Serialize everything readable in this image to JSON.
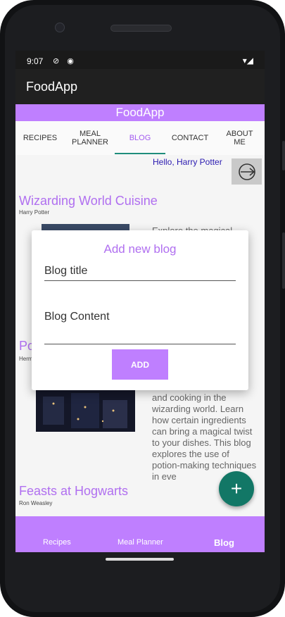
{
  "status": {
    "time": "9:07",
    "left_icons": "⊘ ◉",
    "right_icons": "▾◢"
  },
  "appbar": {
    "title": "FoodApp"
  },
  "banner": {
    "title": "FoodApp"
  },
  "tabs": [
    {
      "label": "RECIPES"
    },
    {
      "label": "MEAL PLANNER"
    },
    {
      "label": "BLOG"
    },
    {
      "label": "CONTACT"
    },
    {
      "label": "ABOUT ME"
    }
  ],
  "greeting": "Hello, Harry Potter",
  "posts": [
    {
      "title": "Wizarding World Cuisine",
      "author": "Harry Potter",
      "excerpt": "Explore the magical"
    },
    {
      "title": "Po",
      "author": "Herm",
      "excerpt": "and cooking in the wizarding world. Learn how certain ingredients can bring a magical twist to your dishes. This blog explores the use of potion-making techniques in eve"
    },
    {
      "title": "Feasts at Hogwarts",
      "author": "Ron Weasley"
    }
  ],
  "dialog": {
    "title": "Add new blog",
    "title_placeholder": "Blog title",
    "content_placeholder": "Blog Content",
    "add_label": "ADD"
  },
  "bottom_nav": [
    {
      "label": "Recipes"
    },
    {
      "label": "Meal Planner"
    },
    {
      "label": "Blog"
    }
  ],
  "fab": {
    "symbol": "+"
  },
  "colors": {
    "accent": "#bf7fff",
    "fab": "#127766",
    "tab_indicator": "#1f8d7b"
  }
}
